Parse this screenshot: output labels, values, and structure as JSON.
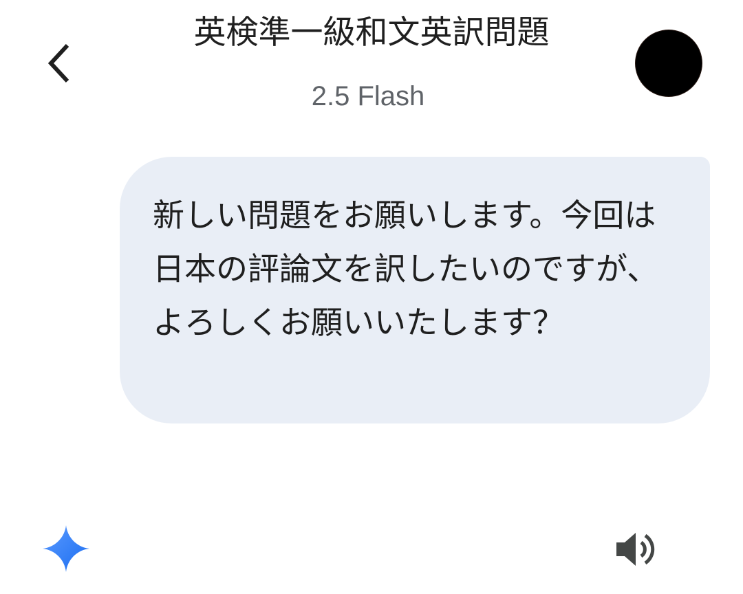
{
  "header": {
    "title": "英検準一級和文英訳問題",
    "subtitle": "2.5 Flash",
    "back_icon": "chevron-left-icon",
    "avatar_icon": "avatar"
  },
  "conversation": {
    "user_message": "新しい問題をお願いします。今回は日本の評論文を訳したいのですが、よろしくお願いいたします？"
  },
  "footer": {
    "assistant_icon": "gemini-sparkle-icon",
    "speaker_icon": "speaker-icon"
  },
  "colors": {
    "bubble": "#e9eef6",
    "subtitle": "#5f6368",
    "sparkle_start": "#4f8dfd",
    "sparkle_end": "#1a6cf0",
    "speaker": "#444746"
  }
}
